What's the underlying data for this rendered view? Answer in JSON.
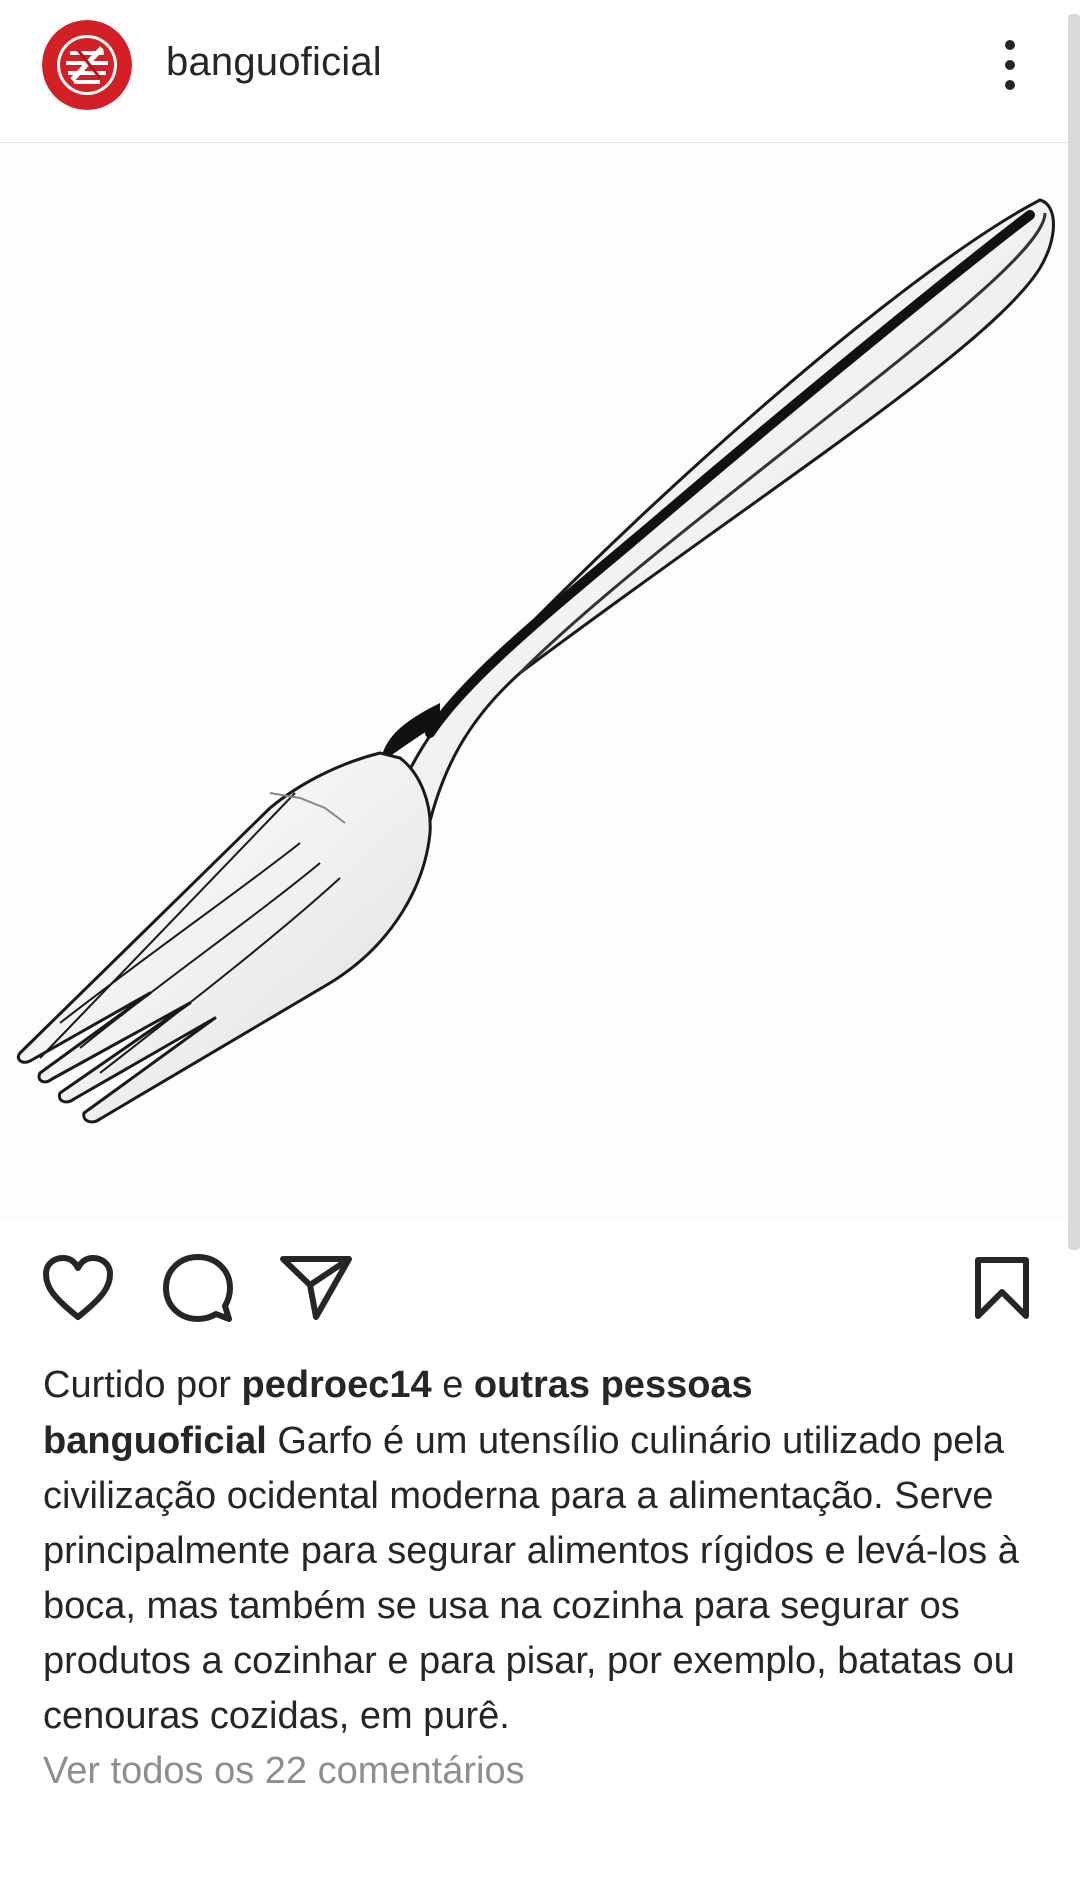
{
  "header": {
    "username": "banguoficial",
    "more_icon": "more-vertical-icon"
  },
  "post": {
    "image_subject": "fork",
    "actions": {
      "like_icon": "heart-icon",
      "comment_icon": "comment-bubble-icon",
      "share_icon": "paper-plane-icon",
      "save_icon": "bookmark-icon"
    },
    "likes": {
      "prefix": "Curtido por",
      "user": "pedroec14",
      "connector": "e",
      "others": "outras pessoas"
    },
    "caption": {
      "username": "banguoficial",
      "text": "Garfo é um utensílio culinário utilizado pela civilização ocidental moderna para a alimentação. Serve principalmente para segurar alimentos rígidos e levá-los à boca, mas também se usa na cozinha para segurar os produtos a cozinhar e para pisar, por exemplo, batatas ou cenouras cozidas, em purê."
    },
    "comments_link": "Ver todos os 22 comentários"
  },
  "colors": {
    "text": "#262626",
    "muted": "#8e8e8e",
    "avatar_red": "#d32027"
  }
}
